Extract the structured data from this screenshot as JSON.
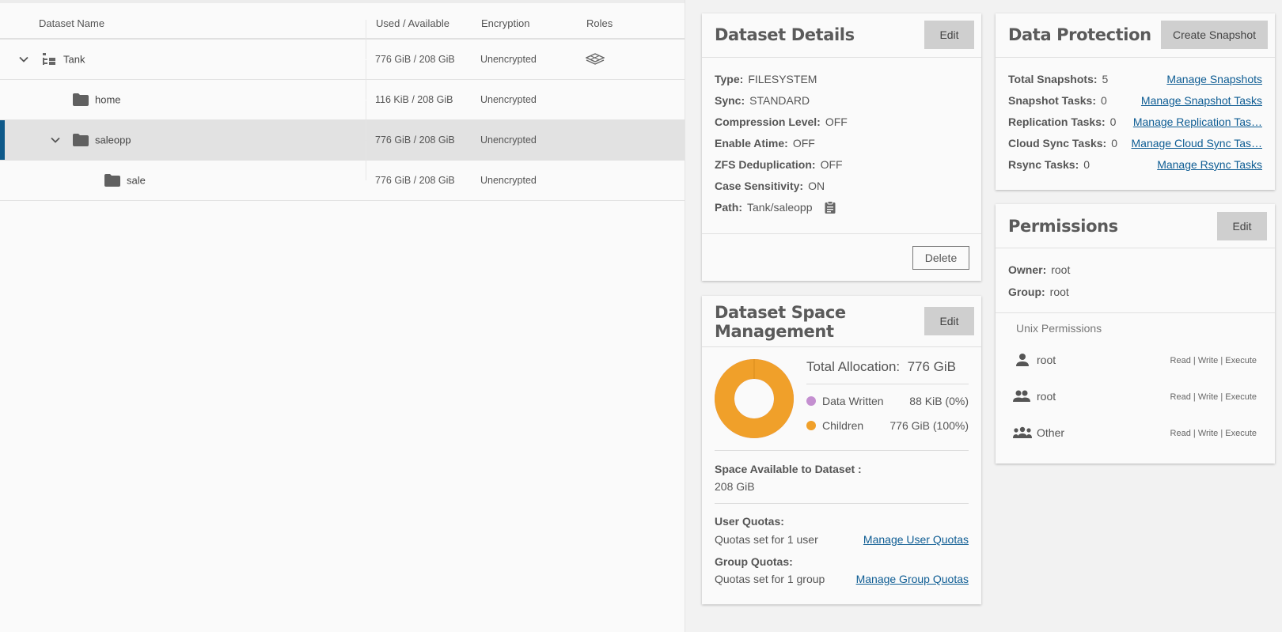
{
  "tree": {
    "columns": {
      "name": "Dataset Name",
      "used": "Used / Available",
      "encryption": "Encryption",
      "roles": "Roles"
    },
    "rows": [
      {
        "name": "Tank",
        "used": "776 GiB / 208 GiB",
        "encryption": "Unencrypted"
      },
      {
        "name": "home",
        "used": "116 KiB / 208 GiB",
        "encryption": "Unencrypted"
      },
      {
        "name": "saleopp",
        "used": "776 GiB / 208 GiB",
        "encryption": "Unencrypted"
      },
      {
        "name": "sale",
        "used": "776 GiB / 208 GiB",
        "encryption": "Unencrypted"
      }
    ]
  },
  "details": {
    "title": "Dataset Details",
    "edit_label": "Edit",
    "delete_label": "Delete",
    "type_label": "Type:",
    "type_value": "FILESYSTEM",
    "sync_label": "Sync:",
    "sync_value": "STANDARD",
    "compression_label": "Compression Level:",
    "compression_value": "OFF",
    "atime_label": "Enable Atime:",
    "atime_value": "OFF",
    "dedup_label": "ZFS Deduplication:",
    "dedup_value": "OFF",
    "case_label": "Case Sensitivity:",
    "case_value": "ON",
    "path_label": "Path:",
    "path_value": "Tank/saleopp"
  },
  "space": {
    "title_line1": "Dataset Space",
    "title_line2": "Management",
    "edit_label": "Edit",
    "total_label": "Total Allocation:",
    "total_value": "776 GiB",
    "data_written_label": "Data Written",
    "data_written_value": "88 KiB (0%)",
    "data_written_color": "#c48fd0",
    "children_label": "Children",
    "children_value": "776 GiB (100%)",
    "children_color": "#f0a02a",
    "children_fraction": 1.0,
    "available_label": "Space Available to Dataset :",
    "available_value": "208 GiB",
    "user_quotas_label": "User Quotas:",
    "user_quotas_value": "Quotas set for 1 user",
    "user_quotas_link": "Manage User Quotas",
    "group_quotas_label": "Group Quotas:",
    "group_quotas_value": "Quotas set for 1 group",
    "group_quotas_link": "Manage Group Quotas"
  },
  "protection": {
    "title": "Data Protection",
    "create_snapshot_label": "Create Snapshot",
    "snapshots_label": "Total Snapshots:",
    "snapshots_value": "5",
    "snapshots_link": "Manage Snapshots",
    "snapshot_tasks_label": "Snapshot Tasks:",
    "snapshot_tasks_value": "0",
    "snapshot_tasks_link": "Manage Snapshot Tasks",
    "replication_label": "Replication Tasks:",
    "replication_value": "0",
    "replication_link": "Manage Replication Tas…",
    "cloud_label": "Cloud Sync Tasks:",
    "cloud_value": "0",
    "cloud_link": "Manage Cloud Sync Tas…",
    "rsync_label": "Rsync Tasks:",
    "rsync_value": "0",
    "rsync_link": "Manage Rsync Tasks"
  },
  "permissions": {
    "title": "Permissions",
    "edit_label": "Edit",
    "owner_label": "Owner:",
    "owner_value": "root",
    "group_label": "Group:",
    "group_value": "root",
    "unix_label": "Unix Permissions",
    "entries": [
      {
        "name": "root",
        "perms": "Read | Write | Execute",
        "icon": "user-icon"
      },
      {
        "name": "root",
        "perms": "Read | Write | Execute",
        "icon": "group-icon"
      },
      {
        "name": "Other",
        "perms": "Read | Write | Execute",
        "icon": "others-icon"
      }
    ]
  }
}
